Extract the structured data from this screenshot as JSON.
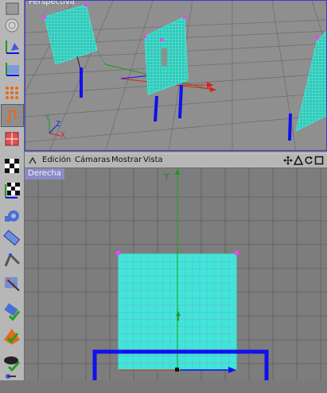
{
  "top_viewport": {
    "label": "Perspectiva"
  },
  "viewport_menu": {
    "items": [
      "Edición",
      "Cámaras",
      "Mostrar",
      "Vista"
    ],
    "nav_icons": [
      "move-view-icon",
      "zoom-view-icon",
      "rotate-view-icon",
      "maximize-view-icon"
    ]
  },
  "side_viewport": {
    "label": "Derecha",
    "axis_y_label": "Y"
  },
  "colors": {
    "mesh": "#3fe6d6",
    "grid_line": "#5b5b5b",
    "handle": "#ff3cff",
    "axis_red": "#e02020",
    "axis_green": "#1e9a1e",
    "axis_blue": "#1010ee",
    "active_border": "#3b3bd8"
  },
  "toolbar": {
    "tools": [
      "sphere-tool-icon",
      "deformer-tool-icon",
      "axis-tool-icon",
      "tube-tool-icon",
      "points-tool-icon",
      "edges-tool-icon",
      "polygons-tool-icon",
      "texture-tool-icon",
      "texture-axis-tool-icon",
      "object-axis-tool-icon",
      "model-tool-icon",
      "bone-tool-icon",
      "inverse-kinematics-icon",
      "paint-tool-icon",
      "enable-axis-icon",
      "enable-snap-icon",
      "brush-tool-icon",
      "light-tool-icon"
    ]
  }
}
